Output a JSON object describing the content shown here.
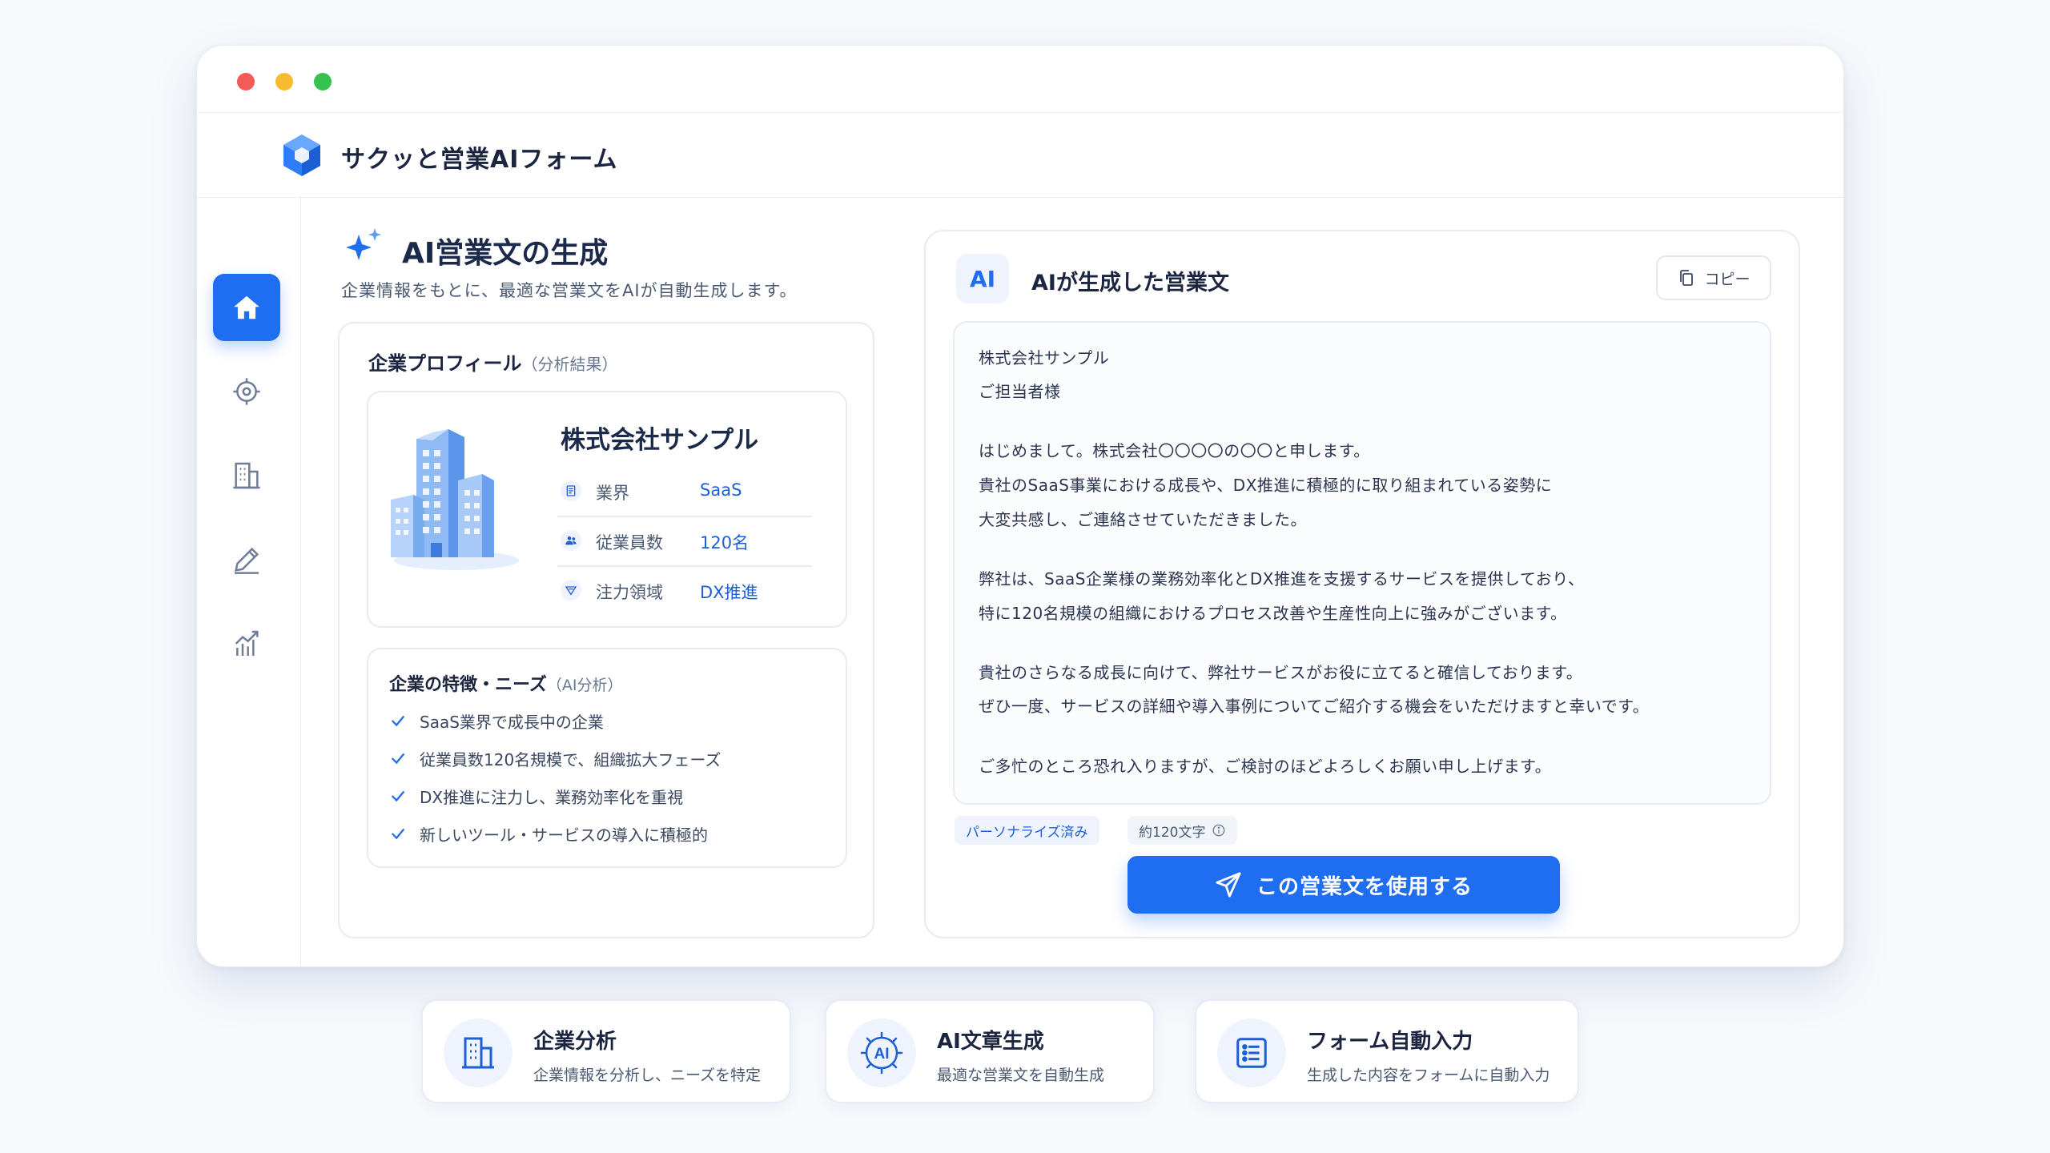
{
  "window": {
    "controls": [
      "close",
      "minimize",
      "maximize"
    ]
  },
  "app": {
    "title": "サクッと営業AIフォーム",
    "logo_icon": "cube-logo-icon"
  },
  "sidebar": {
    "items": [
      {
        "name": "home",
        "icon": "home-icon",
        "active": true
      },
      {
        "name": "target",
        "icon": "target-icon",
        "active": false
      },
      {
        "name": "company",
        "icon": "building-icon",
        "active": false
      },
      {
        "name": "write",
        "icon": "pen-icon",
        "active": false
      },
      {
        "name": "analytics",
        "icon": "chart-icon",
        "active": false
      }
    ]
  },
  "page": {
    "title": "AI営業文の生成",
    "subtitle": "企業情報をもとに、最適な営業文をAIが自動生成します。"
  },
  "profile": {
    "title": "企業プロフィール",
    "title_note": "（分析結果）",
    "company_name": "株式会社サンプル",
    "rows": [
      {
        "label": "業界",
        "value": "SaaS",
        "icon": "document-icon"
      },
      {
        "label": "従業員数",
        "value": "120名",
        "icon": "people-icon"
      },
      {
        "label": "注力領域",
        "value": "DX推進",
        "icon": "focus-icon"
      }
    ]
  },
  "needs": {
    "title": "企業の特徴・ニーズ",
    "title_note": "（AI分析）",
    "items": [
      "SaaS業界で成長中の企業",
      "従業員数120名規模で、組織拡大フェーズ",
      "DX推進に注力し、業務効率化を重視",
      "新しいツール・サービスの導入に積極的"
    ]
  },
  "output": {
    "badge": "AI",
    "title": "AIが生成した営業文",
    "copy_label": "コピー",
    "letter_lines": [
      "株式会社サンプル",
      "ご担当者様",
      "はじめまして。株式会社〇〇〇〇の〇〇と申します。",
      "貴社のSaaS事業における成長や、DX推進に積極的に取り組まれている姿勢に",
      "大変共感し、ご連絡させていただきました。",
      "弊社は、SaaS企業様の業務効率化とDX推進を支援するサービスを提供しており、",
      "特に120名規模の組織におけるプロセス改善や生産性向上に強みがございます。",
      "貴社のさらなる成長に向けて、弊社サービスがお役に立てると確信しております。",
      "ぜひ一度、サービスの詳細や導入事例についてご紹介する機会をいただけますと幸いです。",
      "ご多忙のところ恐れ入りますが、ご検討のほどよろしくお願い申し上げます。"
    ],
    "tag_personalized": "パーソナライズ済み",
    "tag_length": "約120文字",
    "use_button": "この営業文を使用する"
  },
  "features": [
    {
      "title": "企業分析",
      "subtitle": "企業情報を分析し、ニーズを特定",
      "icon": "building-icon"
    },
    {
      "title": "AI文章生成",
      "subtitle": "最適な営業文を自動生成",
      "icon": "ai-chip-icon"
    },
    {
      "title": "フォーム自動入力",
      "subtitle": "生成した内容をフォームに自動入力",
      "icon": "form-icon"
    }
  ],
  "colors": {
    "accent": "#1f6df1",
    "text": "#1c2540",
    "muted": "#4b5a73",
    "close": "#f25b57",
    "minimize": "#f7bb2f",
    "maximize": "#36c24f"
  }
}
